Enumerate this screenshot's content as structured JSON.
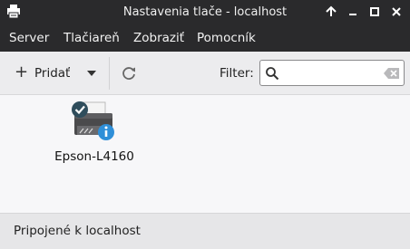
{
  "window": {
    "title": "Nastavenia tlače - localhost",
    "controls": [
      "maximize-up",
      "minimize",
      "maximize",
      "close"
    ]
  },
  "menu": {
    "items": [
      "Server",
      "Tlačiareň",
      "Zobraziť",
      "Pomocník"
    ]
  },
  "toolbar": {
    "add_label": "Pridať",
    "filter_label": "Filter:",
    "filter_value": "",
    "filter_placeholder": ""
  },
  "printers": [
    {
      "name": "Epson-L4160",
      "is_default": true,
      "info_badge": true
    }
  ],
  "status": {
    "text": "Pripojené k localhost"
  },
  "colors": {
    "header_bg": "#2a2a2c",
    "badge_blue": "#2f8fd8",
    "default_badge": "#2f4d5c"
  }
}
